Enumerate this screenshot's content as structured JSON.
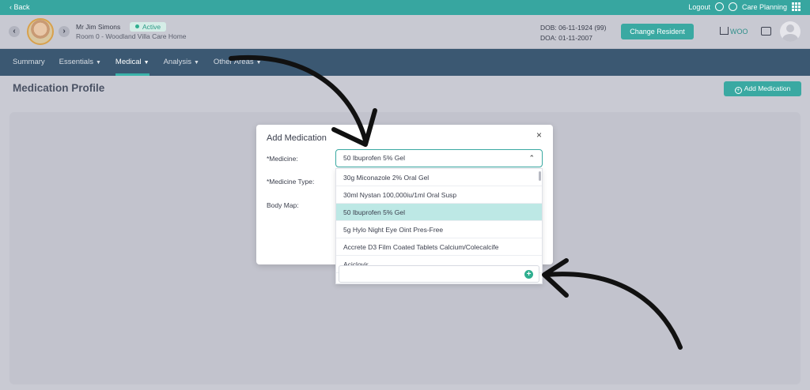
{
  "topbar": {
    "back_label": "‹ Back",
    "logout_label": "Logout",
    "care_planning_label": "Care Planning"
  },
  "resident": {
    "name": "Mr Jim Simons",
    "status": "Active",
    "room": "Room 0 - Woodland Villa Care Home",
    "dob": "DOB: 06-11-1924 (99)",
    "doa": "DOA: 01-11-2007",
    "change_button": "Change Resident",
    "home_code": "WOO"
  },
  "nav": {
    "items": [
      {
        "label": "Summary",
        "has_dropdown": false
      },
      {
        "label": "Essentials",
        "has_dropdown": true
      },
      {
        "label": "Medical",
        "has_dropdown": true,
        "active": true
      },
      {
        "label": "Analysis",
        "has_dropdown": true
      },
      {
        "label": "Other Areas",
        "has_dropdown": true
      }
    ]
  },
  "page": {
    "title": "Medication Profile",
    "add_button": "Add Medication"
  },
  "modal": {
    "title": "Add Medication",
    "close": "×",
    "medicine_label": "*Medicine:",
    "medicine_type_label": "*Medicine Type:",
    "body_map_label": "Body Map:",
    "selected_value": "50 Ibuprofen 5% Gel"
  },
  "dropdown": {
    "options": [
      "30g Miconazole 2% Oral Gel",
      "30ml Nystan 100,000iu/1ml Oral Susp",
      "50 Ibuprofen 5% Gel",
      "5g Hylo Night Eye Oint Pres-Free",
      "Accrete D3 Film Coated Tablets Calcium/Colecalcife",
      "Aciclovir"
    ],
    "selected_index": 2,
    "add_input_placeholder": ""
  },
  "colors": {
    "teal": "#37a6a0",
    "nav": "#3b5872",
    "selected_option": "#bde8e5",
    "background": "#c9cad3"
  }
}
